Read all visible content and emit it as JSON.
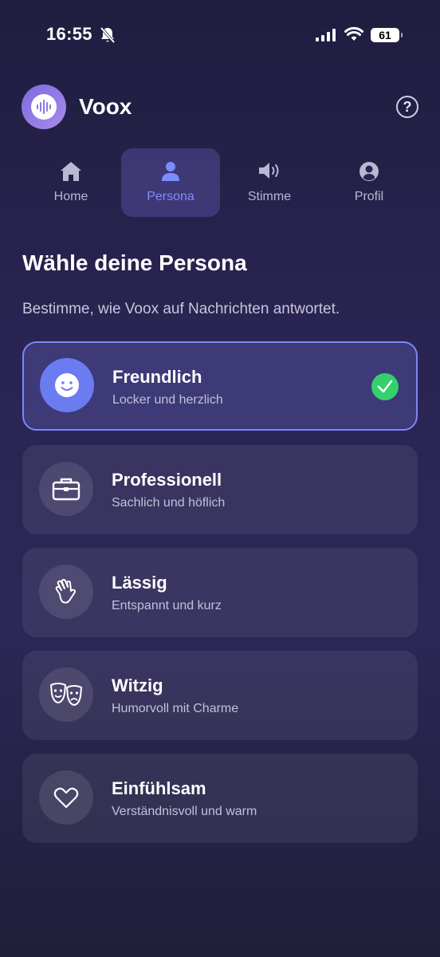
{
  "status_bar": {
    "time": "16:55",
    "battery": "61",
    "icons": [
      "bell-slash-icon",
      "cellular-signal-icon",
      "wifi-icon",
      "battery-icon"
    ]
  },
  "header": {
    "app_name": "Voox",
    "help_symbol": "?",
    "logo_icon": "sound-wave-icon"
  },
  "tabs": [
    {
      "label": "Home",
      "icon": "house-icon",
      "active": false
    },
    {
      "label": "Persona",
      "icon": "person-icon",
      "active": true
    },
    {
      "label": "Stimme",
      "icon": "speaker-icon",
      "active": false
    },
    {
      "label": "Profil",
      "icon": "profile-circle-icon",
      "active": false
    }
  ],
  "main": {
    "title": "Wähle deine Persona",
    "subtitle": "Bestimme, wie Voox auf Nachrichten antwortet."
  },
  "personas": [
    {
      "title": "Freundlich",
      "description": "Locker und herzlich",
      "icon": "smiley-icon",
      "selected": true
    },
    {
      "title": "Professionell",
      "description": "Sachlich und höflich",
      "icon": "briefcase-icon",
      "selected": false
    },
    {
      "title": "Lässig",
      "description": "Entspannt und kurz",
      "icon": "waving-hand-icon",
      "selected": false
    },
    {
      "title": "Witzig",
      "description": "Humorvoll mit Charme",
      "icon": "theater-masks-icon",
      "selected": false
    },
    {
      "title": "Einfühlsam",
      "description": "Verständnisvoll und warm",
      "icon": "heart-icon",
      "selected": false
    }
  ],
  "colors": {
    "accent": "#7d8cff",
    "selected_avatar": "#6b7cf0",
    "check_green": "#34d06b"
  }
}
